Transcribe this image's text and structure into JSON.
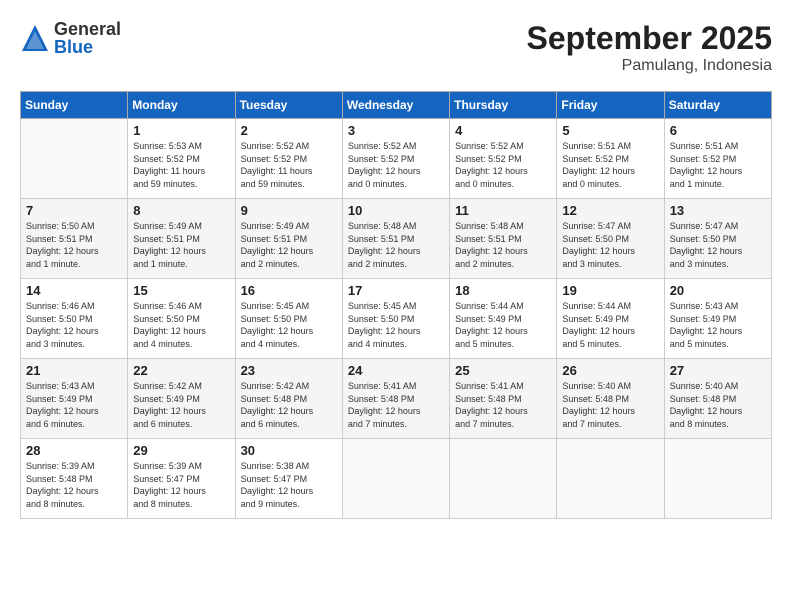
{
  "logo": {
    "general": "General",
    "blue": "Blue"
  },
  "title": "September 2025",
  "location": "Pamulang, Indonesia",
  "headers": [
    "Sunday",
    "Monday",
    "Tuesday",
    "Wednesday",
    "Thursday",
    "Friday",
    "Saturday"
  ],
  "weeks": [
    [
      {
        "day": "",
        "info": ""
      },
      {
        "day": "1",
        "info": "Sunrise: 5:53 AM\nSunset: 5:52 PM\nDaylight: 11 hours\nand 59 minutes."
      },
      {
        "day": "2",
        "info": "Sunrise: 5:52 AM\nSunset: 5:52 PM\nDaylight: 11 hours\nand 59 minutes."
      },
      {
        "day": "3",
        "info": "Sunrise: 5:52 AM\nSunset: 5:52 PM\nDaylight: 12 hours\nand 0 minutes."
      },
      {
        "day": "4",
        "info": "Sunrise: 5:52 AM\nSunset: 5:52 PM\nDaylight: 12 hours\nand 0 minutes."
      },
      {
        "day": "5",
        "info": "Sunrise: 5:51 AM\nSunset: 5:52 PM\nDaylight: 12 hours\nand 0 minutes."
      },
      {
        "day": "6",
        "info": "Sunrise: 5:51 AM\nSunset: 5:52 PM\nDaylight: 12 hours\nand 1 minute."
      }
    ],
    [
      {
        "day": "7",
        "info": "Sunrise: 5:50 AM\nSunset: 5:51 PM\nDaylight: 12 hours\nand 1 minute."
      },
      {
        "day": "8",
        "info": "Sunrise: 5:49 AM\nSunset: 5:51 PM\nDaylight: 12 hours\nand 1 minute."
      },
      {
        "day": "9",
        "info": "Sunrise: 5:49 AM\nSunset: 5:51 PM\nDaylight: 12 hours\nand 2 minutes."
      },
      {
        "day": "10",
        "info": "Sunrise: 5:48 AM\nSunset: 5:51 PM\nDaylight: 12 hours\nand 2 minutes."
      },
      {
        "day": "11",
        "info": "Sunrise: 5:48 AM\nSunset: 5:51 PM\nDaylight: 12 hours\nand 2 minutes."
      },
      {
        "day": "12",
        "info": "Sunrise: 5:47 AM\nSunset: 5:50 PM\nDaylight: 12 hours\nand 3 minutes."
      },
      {
        "day": "13",
        "info": "Sunrise: 5:47 AM\nSunset: 5:50 PM\nDaylight: 12 hours\nand 3 minutes."
      }
    ],
    [
      {
        "day": "14",
        "info": "Sunrise: 5:46 AM\nSunset: 5:50 PM\nDaylight: 12 hours\nand 3 minutes."
      },
      {
        "day": "15",
        "info": "Sunrise: 5:46 AM\nSunset: 5:50 PM\nDaylight: 12 hours\nand 4 minutes."
      },
      {
        "day": "16",
        "info": "Sunrise: 5:45 AM\nSunset: 5:50 PM\nDaylight: 12 hours\nand 4 minutes."
      },
      {
        "day": "17",
        "info": "Sunrise: 5:45 AM\nSunset: 5:50 PM\nDaylight: 12 hours\nand 4 minutes."
      },
      {
        "day": "18",
        "info": "Sunrise: 5:44 AM\nSunset: 5:49 PM\nDaylight: 12 hours\nand 5 minutes."
      },
      {
        "day": "19",
        "info": "Sunrise: 5:44 AM\nSunset: 5:49 PM\nDaylight: 12 hours\nand 5 minutes."
      },
      {
        "day": "20",
        "info": "Sunrise: 5:43 AM\nSunset: 5:49 PM\nDaylight: 12 hours\nand 5 minutes."
      }
    ],
    [
      {
        "day": "21",
        "info": "Sunrise: 5:43 AM\nSunset: 5:49 PM\nDaylight: 12 hours\nand 6 minutes."
      },
      {
        "day": "22",
        "info": "Sunrise: 5:42 AM\nSunset: 5:49 PM\nDaylight: 12 hours\nand 6 minutes."
      },
      {
        "day": "23",
        "info": "Sunrise: 5:42 AM\nSunset: 5:48 PM\nDaylight: 12 hours\nand 6 minutes."
      },
      {
        "day": "24",
        "info": "Sunrise: 5:41 AM\nSunset: 5:48 PM\nDaylight: 12 hours\nand 7 minutes."
      },
      {
        "day": "25",
        "info": "Sunrise: 5:41 AM\nSunset: 5:48 PM\nDaylight: 12 hours\nand 7 minutes."
      },
      {
        "day": "26",
        "info": "Sunrise: 5:40 AM\nSunset: 5:48 PM\nDaylight: 12 hours\nand 7 minutes."
      },
      {
        "day": "27",
        "info": "Sunrise: 5:40 AM\nSunset: 5:48 PM\nDaylight: 12 hours\nand 8 minutes."
      }
    ],
    [
      {
        "day": "28",
        "info": "Sunrise: 5:39 AM\nSunset: 5:48 PM\nDaylight: 12 hours\nand 8 minutes."
      },
      {
        "day": "29",
        "info": "Sunrise: 5:39 AM\nSunset: 5:47 PM\nDaylight: 12 hours\nand 8 minutes."
      },
      {
        "day": "30",
        "info": "Sunrise: 5:38 AM\nSunset: 5:47 PM\nDaylight: 12 hours\nand 9 minutes."
      },
      {
        "day": "",
        "info": ""
      },
      {
        "day": "",
        "info": ""
      },
      {
        "day": "",
        "info": ""
      },
      {
        "day": "",
        "info": ""
      }
    ]
  ]
}
